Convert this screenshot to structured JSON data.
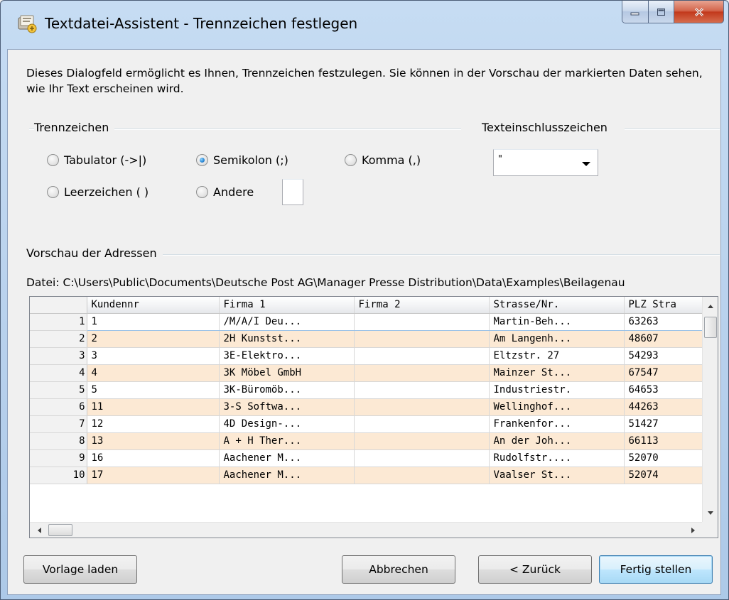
{
  "window": {
    "title": "Textdatei-Assistent - Trennzeichen festlegen"
  },
  "intro": "Dieses Dialogfeld ermöglicht es Ihnen, Trennzeichen festzulegen. Sie können in der Vorschau der markierten Daten sehen, wie Ihr Text erscheinen wird.",
  "delimiters": {
    "group_label": "Trennzeichen",
    "options": [
      {
        "label": "Tabulator (->|)",
        "checked": false
      },
      {
        "label": "Semikolon (;)",
        "checked": true
      },
      {
        "label": "Komma (,)",
        "checked": false
      },
      {
        "label": "Leerzeichen ( )",
        "checked": false
      },
      {
        "label": "Andere",
        "checked": false
      }
    ],
    "other_value": ""
  },
  "text_qualifier": {
    "group_label": "Texteinschlusszeichen",
    "value": "\""
  },
  "preview": {
    "group_label": "Vorschau der Adressen",
    "file_path": "Datei: C:\\Users\\Public\\Documents\\Deutsche Post AG\\Manager Presse Distribution\\Data\\Examples\\Beilagenau",
    "columns": [
      "Kundennr",
      "Firma 1",
      "Firma 2",
      "Strasse/Nr.",
      "PLZ Stra"
    ],
    "rows": [
      {
        "n": "1",
        "cells": [
          "1",
          "/M/A/I Deu...",
          "",
          "Martin-Beh...",
          "63263"
        ]
      },
      {
        "n": "2",
        "cells": [
          "2",
          "2H Kunstst...",
          "",
          "Am Langenh...",
          "48607"
        ]
      },
      {
        "n": "3",
        "cells": [
          "3",
          "3E-Elektro...",
          "",
          "Eltzstr. 27",
          "54293"
        ]
      },
      {
        "n": "4",
        "cells": [
          "4",
          "3K Möbel GmbH",
          "",
          "Mainzer St...",
          "67547"
        ]
      },
      {
        "n": "5",
        "cells": [
          "5",
          "3K-Büromöb...",
          "",
          "Industriestr.",
          "64653"
        ]
      },
      {
        "n": "6",
        "cells": [
          "11",
          "3-S Softwa...",
          "",
          "Wellinghof...",
          "44263"
        ]
      },
      {
        "n": "7",
        "cells": [
          "12",
          "4D Design-...",
          "",
          "Frankenfor...",
          "51427"
        ]
      },
      {
        "n": "8",
        "cells": [
          "13",
          "A + H Ther...",
          "",
          "An der Joh...",
          "66113"
        ]
      },
      {
        "n": "9",
        "cells": [
          "16",
          "Aachener M...",
          "",
          "Rudolfstr....",
          "52070"
        ]
      },
      {
        "n": "10",
        "cells": [
          "17",
          "Aachener M...",
          "",
          "Vaalser St...",
          "52074"
        ]
      }
    ],
    "row_colors": {
      "odd": "#ffffff",
      "even": "#fce9d4"
    }
  },
  "buttons": {
    "load_template": "Vorlage laden",
    "cancel": "Abbrechen",
    "back": "< Zurück",
    "finish": "Fertig stellen"
  }
}
